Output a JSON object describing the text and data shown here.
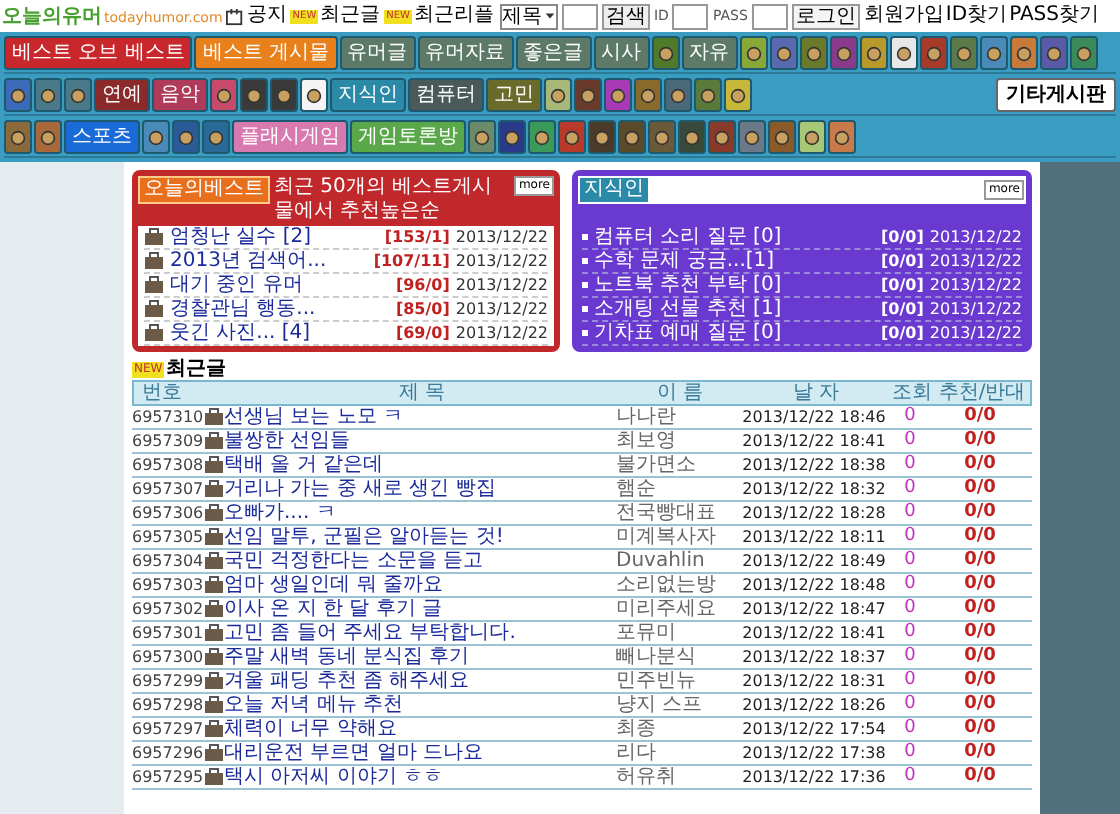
{
  "header": {
    "logo": {
      "title": "오늘의유머",
      "subtitle": "todayhumor.com"
    },
    "links": [
      {
        "text": "공지"
      },
      {
        "text": "최근글",
        "badge": "NEW"
      },
      {
        "text": "최근리플",
        "badge": "NEW"
      }
    ],
    "search": {
      "field_option": "제목",
      "button": "검색"
    },
    "login": {
      "id_label": "ID",
      "pass_label": "PASS",
      "button": "로그인"
    },
    "account_links": [
      "회원가입",
      "ID찾기",
      "PASS찾기"
    ]
  },
  "toolbar": {
    "rows": [
      {
        "items": [
          {
            "kind": "label",
            "text": "베스트 오브 베스트",
            "color": "#c8282c"
          },
          {
            "kind": "label",
            "text": "베스트 게시물",
            "color": "#e8801c"
          },
          {
            "kind": "label",
            "text": "유머글",
            "color": "#5d7a68"
          },
          {
            "kind": "label",
            "text": "유머자료",
            "color": "#5d7a68"
          },
          {
            "kind": "label",
            "text": "좋은글",
            "color": "#5d7a68"
          },
          {
            "kind": "label",
            "text": "시사",
            "color": "#5d7a68"
          },
          {
            "kind": "icon",
            "color": "#4e7a2a"
          },
          {
            "kind": "label",
            "text": "자유",
            "color": "#5d7a68"
          },
          {
            "kind": "icon",
            "color": "#8aa838"
          },
          {
            "kind": "icon",
            "color": "#5a6ab0"
          },
          {
            "kind": "icon",
            "color": "#6a7a2a"
          },
          {
            "kind": "icon",
            "color": "#8a3a8a"
          },
          {
            "kind": "icon",
            "color": "#b89a2a"
          },
          {
            "kind": "icon",
            "color": "#e8e8e8"
          },
          {
            "kind": "icon",
            "color": "#a83a2a"
          },
          {
            "kind": "icon",
            "color": "#5a7a4a"
          },
          {
            "kind": "icon",
            "color": "#4a8ab8"
          },
          {
            "kind": "icon",
            "color": "#c87a3a"
          },
          {
            "kind": "icon",
            "color": "#5a5aa8"
          },
          {
            "kind": "icon",
            "color": "#3a8a5a"
          }
        ]
      },
      {
        "items": [
          {
            "kind": "icon",
            "color": "#3a6ab8"
          },
          {
            "kind": "icon",
            "color": "#4a7a8a"
          },
          {
            "kind": "icon",
            "color": "#4a7a8a"
          },
          {
            "kind": "label",
            "text": "연예",
            "color": "#8a2a2a"
          },
          {
            "kind": "label",
            "text": "음악",
            "color": "#b03a5a"
          },
          {
            "kind": "icon",
            "color": "#c84a6a"
          },
          {
            "kind": "icon",
            "color": "#3a3a3a"
          },
          {
            "kind": "icon",
            "color": "#3a3a3a"
          },
          {
            "kind": "icon",
            "color": "#f4f4f4"
          },
          {
            "kind": "label",
            "text": "지식인",
            "color": "#2a8aa8"
          },
          {
            "kind": "label",
            "text": "컴퓨터",
            "color": "#4a5a5a"
          },
          {
            "kind": "label",
            "text": "고민",
            "color": "#6a6a2a"
          },
          {
            "kind": "icon",
            "color": "#a8b878"
          },
          {
            "kind": "icon",
            "color": "#6a3a2a"
          },
          {
            "kind": "icon",
            "color": "#a83ab8"
          },
          {
            "kind": "icon",
            "color": "#8a6a2a"
          },
          {
            "kind": "icon",
            "color": "#4a6a7a"
          },
          {
            "kind": "icon",
            "color": "#5a7a3a"
          },
          {
            "kind": "icon",
            "color": "#c8b83a"
          }
        ]
      },
      {
        "items": [
          {
            "kind": "icon",
            "color": "#8a6a3a"
          },
          {
            "kind": "icon",
            "color": "#a8683a"
          },
          {
            "kind": "label",
            "text": "스포츠",
            "color": "#1a6ad8"
          },
          {
            "kind": "icon",
            "color": "#4a8ab8"
          },
          {
            "kind": "icon",
            "color": "#2a5a98"
          },
          {
            "kind": "icon",
            "color": "#2a6a98"
          },
          {
            "kind": "label",
            "text": "플래시게임",
            "color": "#d87ab0"
          },
          {
            "kind": "label",
            "text": "게임토론방",
            "color": "#5aa84a"
          },
          {
            "kind": "icon",
            "color": "#6a8a6a"
          },
          {
            "kind": "icon",
            "color": "#2a3a8a"
          },
          {
            "kind": "icon",
            "color": "#3a9a5a"
          },
          {
            "kind": "icon",
            "color": "#b83a2a"
          },
          {
            "kind": "icon",
            "color": "#4a3a2a"
          },
          {
            "kind": "icon",
            "color": "#5a4a2a"
          },
          {
            "kind": "icon",
            "color": "#6a5a3a"
          },
          {
            "kind": "icon",
            "color": "#3a4a3a"
          },
          {
            "kind": "icon",
            "color": "#8a3a2a"
          },
          {
            "kind": "icon",
            "color": "#6a7a8a"
          },
          {
            "kind": "icon",
            "color": "#8a5a2a"
          },
          {
            "kind": "icon",
            "color": "#a8c878"
          },
          {
            "kind": "icon",
            "color": "#c87a4a"
          }
        ]
      }
    ],
    "extra_button": "기타게시판"
  },
  "best": {
    "tab": "오늘의베스트",
    "caption": "최근 50개의 베스트게시물에서 추천높은순",
    "more": "more",
    "rows": [
      {
        "title": "엄청난 실수 [2]",
        "count": "[153/1]",
        "date": "2013/12/22"
      },
      {
        "title": "2013년 검색어...",
        "count": "[107/11]",
        "date": "2013/12/22"
      },
      {
        "title": "대기 중인 유머",
        "count": "[96/0]",
        "date": "2013/12/22"
      },
      {
        "title": "경찰관님 행동...",
        "count": "[85/0]",
        "date": "2013/12/22"
      },
      {
        "title": "웃긴 사진... [4]",
        "count": "[69/0]",
        "date": "2013/12/22"
      }
    ]
  },
  "knowledge": {
    "tab": "지식인",
    "more": "more",
    "rows": [
      {
        "title": "컴퓨터 소리 질문 [0]",
        "count": "[0/0]",
        "date": "2013/12/22"
      },
      {
        "title": "수학 문제 궁금...[1]",
        "count": "[0/0]",
        "date": "2013/12/22"
      },
      {
        "title": "노트북 추천 부탁 [0]",
        "count": "[0/0]",
        "date": "2013/12/22"
      },
      {
        "title": "소개팅 선물 추천 [1]",
        "count": "[0/0]",
        "date": "2013/12/22"
      },
      {
        "title": "기차표 예매 질문 [0]",
        "count": "[0/0]",
        "date": "2013/12/22"
      }
    ]
  },
  "latest": {
    "badge": "NEW",
    "heading": "최근글",
    "columns": [
      "번호",
      "제 목",
      "이 름",
      "날 자",
      "조회",
      "추천/반대"
    ],
    "rows": [
      {
        "number": "6957310",
        "title": "선생님 보는 노모 ㅋ",
        "name": "나나란",
        "date": "2013/12/22 18:46",
        "views": "0",
        "votes": "0/0"
      },
      {
        "number": "6957309",
        "title": "불쌍한 선임들",
        "name": "최보영",
        "date": "2013/12/22 18:41",
        "views": "0",
        "votes": "0/0"
      },
      {
        "number": "6957308",
        "title": "택배 올 거 같은데",
        "name": "불가면소",
        "date": "2013/12/22 18:38",
        "views": "0",
        "votes": "0/0"
      },
      {
        "number": "6957307",
        "title": "거리나 가는 중 새로 생긴 빵집",
        "name": "햄순",
        "date": "2013/12/22 18:32",
        "views": "0",
        "votes": "0/0"
      },
      {
        "number": "6957306",
        "title": "오빠가.... ㅋ",
        "name": "전국빵대표",
        "date": "2013/12/22 18:28",
        "views": "0",
        "votes": "0/0"
      },
      {
        "number": "6957305",
        "title": "선임 말투, 군필은 알아듣는 것!",
        "name": "미계복사자",
        "date": "2013/12/22 18:11",
        "views": "0",
        "votes": "0/0"
      },
      {
        "number": "6957304",
        "title": "국민 걱정한다는 소문을 듣고",
        "name": "Duvahlin",
        "date": "2013/12/22 18:49",
        "views": "0",
        "votes": "0/0"
      },
      {
        "number": "6957303",
        "title": "엄마 생일인데 뭐 줄까요",
        "name": "소리없는방",
        "date": "2013/12/22 18:48",
        "views": "0",
        "votes": "0/0"
      },
      {
        "number": "6957302",
        "title": "이사 온 지 한 달 후기 글",
        "name": "미리주세요",
        "date": "2013/12/22 18:47",
        "views": "0",
        "votes": "0/0"
      },
      {
        "number": "6957301",
        "title": "고민 좀 들어 주세요 부탁합니다.",
        "name": "포뮤미",
        "date": "2013/12/22 18:41",
        "views": "0",
        "votes": "0/0"
      },
      {
        "number": "6957300",
        "title": "주말 새벽 동네 분식집 후기",
        "name": "빼나분식",
        "date": "2013/12/22 18:37",
        "views": "0",
        "votes": "0/0"
      },
      {
        "number": "6957299",
        "title": "겨울 패딩 추천 좀 해주세요",
        "name": "민주빈뉴",
        "date": "2013/12/22 18:31",
        "views": "0",
        "votes": "0/0"
      },
      {
        "number": "6957298",
        "title": "오늘 저녁 메뉴 추천",
        "name": "냥지 스프",
        "date": "2013/12/22 18:26",
        "views": "0",
        "votes": "0/0"
      },
      {
        "number": "6957297",
        "title": "체력이 너무 약해요",
        "name": "최종",
        "date": "2013/12/22 17:54",
        "views": "0",
        "votes": "0/0"
      },
      {
        "number": "6957296",
        "title": "대리운전 부르면 얼마 드나요",
        "name": "리다",
        "date": "2013/12/22 17:38",
        "views": "0",
        "votes": "0/0"
      },
      {
        "number": "6957295",
        "title": "택시 아저씨 이야기 ㅎㅎ",
        "name": "허유취",
        "date": "2013/12/22 17:36",
        "views": "0",
        "votes": "0/0"
      }
    ]
  }
}
